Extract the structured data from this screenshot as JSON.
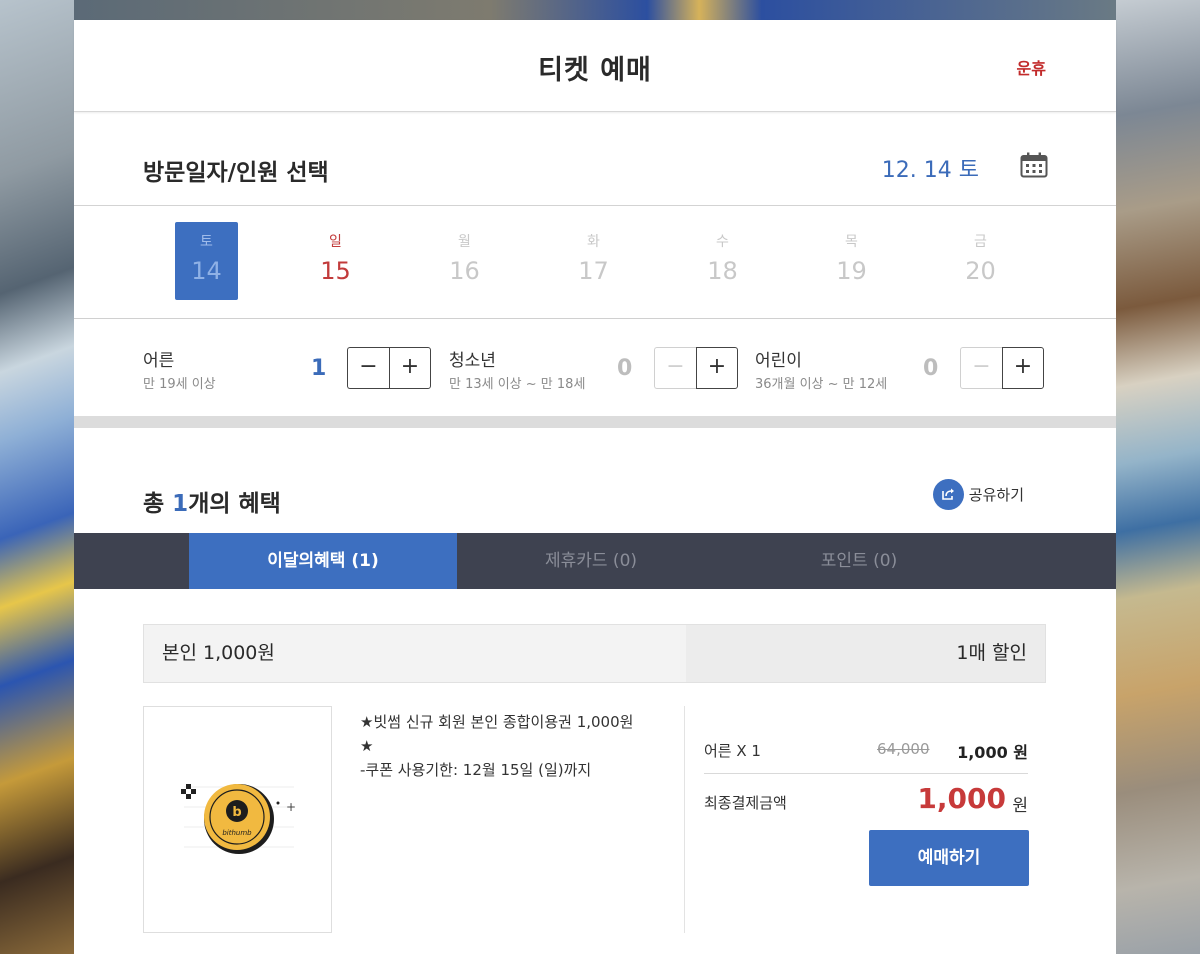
{
  "header": {
    "title": "티켓 예매",
    "status": "운휴"
  },
  "date_section": {
    "label": "방문일자/인원 선택",
    "selected_date": "12. 14 토",
    "days": [
      {
        "dow": "토",
        "num": "14",
        "state": "selected"
      },
      {
        "dow": "일",
        "num": "15",
        "state": "sunday"
      },
      {
        "dow": "월",
        "num": "16",
        "state": "disabled"
      },
      {
        "dow": "화",
        "num": "17",
        "state": "disabled"
      },
      {
        "dow": "수",
        "num": "18",
        "state": "disabled"
      },
      {
        "dow": "목",
        "num": "19",
        "state": "disabled"
      },
      {
        "dow": "금",
        "num": "20",
        "state": "disabled"
      }
    ]
  },
  "people": [
    {
      "name": "어른",
      "range": "만 19세 이상",
      "count": "1",
      "minus": "−",
      "plus": "+"
    },
    {
      "name": "청소년",
      "range": "만 13세 이상 ~ 만 18세",
      "count": "0",
      "minus": "−",
      "plus": "+"
    },
    {
      "name": "어린이",
      "range": "36개월 이상 ~ 만 12세",
      "count": "0",
      "minus": "−",
      "plus": "+"
    }
  ],
  "benefits": {
    "title_prefix": "총 ",
    "count": "1",
    "title_suffix": "개의 혜택",
    "share_label": "공유하기",
    "tabs": [
      {
        "label": "이달의혜택 (1)",
        "active": true
      },
      {
        "label": "제휴카드 (0)",
        "active": false
      },
      {
        "label": "포인트 (0)",
        "active": false
      }
    ]
  },
  "coupon": {
    "name": "본인 1,000원",
    "discount": "1매 할인",
    "logo_text": "bithumb",
    "desc_line1": "★빗썸 신규 회원 본인 종합이용권 1,000원",
    "desc_line2": "★",
    "desc_line3": "-쿠폰 사용기한: 12월 15일 (일)까지"
  },
  "price": {
    "row_label": "어른 X 1",
    "original": "64,000",
    "amount": "1,000 원",
    "final_label": "최종결제금액",
    "final_amount": "1,000",
    "final_unit": "원",
    "book_button": "예매하기"
  },
  "colors": {
    "accent": "#3d6fc0",
    "price_red": "#c73a3a",
    "tab_bar": "#3e4250"
  }
}
